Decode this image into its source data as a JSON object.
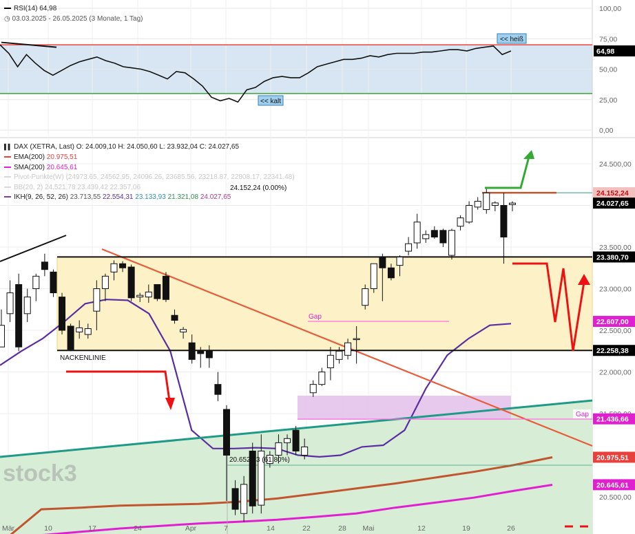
{
  "rsi_panel": {
    "title": "RSI(14)",
    "value": "64,98",
    "subtitle": "03.03.2025 - 26.05.2025",
    "period": "(3 Monate, 1 Tag)",
    "label_hot": "<< heiß",
    "label_cold": "<< kalt",
    "tag_value": "64,98",
    "ticks": [
      "100,00",
      "75,00",
      "50,00",
      "25,00",
      "0,00"
    ]
  },
  "price_panel": {
    "title": "DAX (XETRA, Last)",
    "ohlc": "O: 24.009,10  H: 24.050,60  L: 23.932,04  C: 24.027,65",
    "legend": [
      {
        "label": "EMA(200)",
        "value": "20.975,51",
        "color": "#e8413c",
        "faded": false
      },
      {
        "label": "SMA(200)",
        "value": "20.645,61",
        "color": "#e020d0",
        "faded": false
      },
      {
        "label": "Pivot-Punkte(W)",
        "value": "(24973.65, 24562.95, 24096.26, 23685.56, 23218.87, 22808.17, 22341.48)",
        "color": "#d8d8d8",
        "faded": true
      },
      {
        "label": "BB(20, 2)",
        "value": "24.521,78  23.439,42  22.357,06",
        "color": "#d8d8d8",
        "faded": true
      }
    ],
    "ikh": {
      "label": "IKH(9, 26, 52, 26)",
      "v1": "23.713,55",
      "v2": "22.554,31",
      "v3": "23.133,93",
      "v4": "21.321,08",
      "v5": "24.027,65"
    },
    "high_note": "24.152,24 (0.00%)",
    "fib_note": "20.652,53 (61.80%)",
    "neckline_label": "NACKENLINIE",
    "gap_label_1": "Gap",
    "gap_label_2": "Gap",
    "price_ticks": [
      "24.500,00",
      "24.000,00",
      "23.500,00",
      "23.000,00",
      "22.500,00",
      "22.000,00",
      "21.500,00",
      "21.000,00",
      "20.500,00"
    ],
    "tags": [
      {
        "text": "24.152,24",
        "bg": "#f3c0c0",
        "fg": "#c01010"
      },
      {
        "text": "24.027,65",
        "bg": "#000000",
        "fg": "#ffffff"
      },
      {
        "text": "23.380,70",
        "bg": "#000000",
        "fg": "#ffffff"
      },
      {
        "text": "22.607,00",
        "bg": "#e020d0",
        "fg": "#ffffff"
      },
      {
        "text": "22.258,38",
        "bg": "#000000",
        "fg": "#ffffff"
      },
      {
        "text": "21.436,66",
        "bg": "#e020d0",
        "fg": "#ffffff"
      },
      {
        "text": "20.975,51",
        "bg": "#e8413c",
        "fg": "#ffffff"
      },
      {
        "text": "20.645,61",
        "bg": "#e020d0",
        "fg": "#ffffff"
      }
    ],
    "x_ticks": [
      "Mär",
      "10",
      "17",
      "24",
      "Apr",
      "7",
      "14",
      "22",
      "28",
      "Mai",
      "12",
      "19",
      "26"
    ],
    "watermark": "stock3"
  },
  "chart_data": {
    "type": "candlestick",
    "title": "DAX (XETRA, Last)",
    "period": "03.03.2025 - 26.05.2025",
    "y_range": [
      20250,
      24800
    ],
    "candles": [
      {
        "o": 22300,
        "h": 22750,
        "l": 22300,
        "c": 22560
      },
      {
        "o": 22700,
        "h": 23100,
        "l": 22600,
        "c": 22950
      },
      {
        "o": 23050,
        "h": 23180,
        "l": 22250,
        "c": 22300
      },
      {
        "o": 22700,
        "h": 23000,
        "l": 22600,
        "c": 22900
      },
      {
        "o": 23000,
        "h": 23180,
        "l": 22850,
        "c": 23150
      },
      {
        "o": 23320,
        "h": 23420,
        "l": 23150,
        "c": 23230
      },
      {
        "o": 23200,
        "h": 23230,
        "l": 22900,
        "c": 22950
      },
      {
        "o": 22900,
        "h": 22950,
        "l": 22450,
        "c": 22500
      },
      {
        "o": 22550,
        "h": 22580,
        "l": 22250,
        "c": 22270
      },
      {
        "o": 22480,
        "h": 22620,
        "l": 22400,
        "c": 22530
      },
      {
        "o": 22450,
        "h": 22580,
        "l": 22400,
        "c": 22520
      },
      {
        "o": 22730,
        "h": 23100,
        "l": 22500,
        "c": 23000
      },
      {
        "o": 23000,
        "h": 23180,
        "l": 22850,
        "c": 23150
      },
      {
        "o": 23200,
        "h": 23340,
        "l": 23100,
        "c": 23300
      },
      {
        "o": 23300,
        "h": 23330,
        "l": 23200,
        "c": 23250
      },
      {
        "o": 23260,
        "h": 23290,
        "l": 22850,
        "c": 22890
      },
      {
        "o": 22900,
        "h": 22950,
        "l": 22840,
        "c": 22920
      },
      {
        "o": 22900,
        "h": 23050,
        "l": 22830,
        "c": 22960
      },
      {
        "o": 23050,
        "h": 23050,
        "l": 22850,
        "c": 22880
      },
      {
        "o": 23150,
        "h": 23200,
        "l": 22840,
        "c": 22870
      },
      {
        "o": 22680,
        "h": 22750,
        "l": 22580,
        "c": 22620
      },
      {
        "o": 22480,
        "h": 22540,
        "l": 22400,
        "c": 22510
      },
      {
        "o": 22350,
        "h": 22450,
        "l": 22100,
        "c": 22150
      },
      {
        "o": 22250,
        "h": 22300,
        "l": 22050,
        "c": 22220
      },
      {
        "o": 22250,
        "h": 22320,
        "l": 22050,
        "c": 22170
      },
      {
        "o": 21850,
        "h": 22000,
        "l": 21650,
        "c": 21730
      },
      {
        "o": 21550,
        "h": 21600,
        "l": 20450,
        "c": 21000
      },
      {
        "o": 20600,
        "h": 20700,
        "l": 20280,
        "c": 20350
      },
      {
        "o": 20300,
        "h": 20750,
        "l": 20200,
        "c": 20650
      },
      {
        "o": 21050,
        "h": 21150,
        "l": 20300,
        "c": 20390
      },
      {
        "o": 20400,
        "h": 21250,
        "l": 20300,
        "c": 21050
      },
      {
        "o": 20900,
        "h": 21050,
        "l": 20850,
        "c": 21000
      },
      {
        "o": 21000,
        "h": 21250,
        "l": 20900,
        "c": 21150
      },
      {
        "o": 21150,
        "h": 21250,
        "l": 21000,
        "c": 21200
      },
      {
        "o": 21300,
        "h": 21350,
        "l": 21000,
        "c": 21050
      },
      {
        "o": 21000,
        "h": 21200,
        "l": 20950,
        "c": 21100
      },
      {
        "o": 21750,
        "h": 21900,
        "l": 21700,
        "c": 21850
      },
      {
        "o": 21850,
        "h": 22050,
        "l": 21830,
        "c": 22000
      },
      {
        "o": 22050,
        "h": 22300,
        "l": 21900,
        "c": 22200
      },
      {
        "o": 22150,
        "h": 22300,
        "l": 22100,
        "c": 22250
      },
      {
        "o": 22200,
        "h": 22400,
        "l": 22150,
        "c": 22350
      },
      {
        "o": 22400,
        "h": 22550,
        "l": 22100,
        "c": 22400
      },
      {
        "o": 22800,
        "h": 23050,
        "l": 22750,
        "c": 23000
      },
      {
        "o": 23000,
        "h": 23300,
        "l": 22950,
        "c": 23300
      },
      {
        "o": 23380,
        "h": 23420,
        "l": 22850,
        "c": 23250
      },
      {
        "o": 23250,
        "h": 23300,
        "l": 23100,
        "c": 23130
      },
      {
        "o": 23280,
        "h": 23400,
        "l": 23150,
        "c": 23380
      },
      {
        "o": 23450,
        "h": 23620,
        "l": 23400,
        "c": 23540
      },
      {
        "o": 23550,
        "h": 23900,
        "l": 23480,
        "c": 23800
      },
      {
        "o": 23600,
        "h": 23700,
        "l": 23550,
        "c": 23650
      },
      {
        "o": 23700,
        "h": 23750,
        "l": 23600,
        "c": 23620
      },
      {
        "o": 23700,
        "h": 23720,
        "l": 23500,
        "c": 23550
      },
      {
        "o": 23400,
        "h": 23720,
        "l": 23350,
        "c": 23700
      },
      {
        "o": 23750,
        "h": 23880,
        "l": 23700,
        "c": 23850
      },
      {
        "o": 23800,
        "h": 24050,
        "l": 23780,
        "c": 24000
      },
      {
        "o": 23980,
        "h": 24100,
        "l": 23950,
        "c": 24050
      },
      {
        "o": 23950,
        "h": 24200,
        "l": 23900,
        "c": 24150
      },
      {
        "o": 24000,
        "h": 24050,
        "l": 23930,
        "c": 24030
      },
      {
        "o": 24000,
        "h": 24150,
        "l": 23300,
        "c": 23620
      },
      {
        "o": 24010,
        "h": 24050,
        "l": 23930,
        "c": 24028
      }
    ],
    "lines": {
      "EMA(200)": [
        20350,
        20370,
        20395,
        20405,
        20415,
        20440,
        20480,
        20540,
        20600,
        20660,
        20730,
        20800,
        20880,
        20975
      ],
      "SMA(200)": [
        20040,
        20080,
        20120,
        20150,
        20180,
        20200,
        20225,
        20260,
        20300,
        20370,
        20430,
        20490,
        20570,
        20645
      ],
      "IKH": [
        22080,
        22250,
        22400,
        22600,
        22820,
        22870,
        22860,
        22700,
        22250,
        21300,
        21080,
        21080,
        21090,
        21080,
        21000,
        20980,
        21000,
        21100,
        21120,
        21300,
        21800,
        22200,
        22400,
        22560,
        22580
      ]
    },
    "levels": {
      "high": 24152.24,
      "last": 24027.65,
      "zone_upper": 23380.7,
      "zone_lower": 22258.38,
      "gap_upper": 22607.0,
      "gap_lower": 21436.66,
      "ema200": 20975.51,
      "sma200": 20645.61,
      "fib_61_8": 20652.53
    },
    "rsi": {
      "value": 64.98,
      "range": [
        0,
        100
      ],
      "upper": 70,
      "lower": 30,
      "series": [
        70,
        63,
        52,
        62,
        55,
        49,
        45,
        49,
        53,
        56,
        58,
        60,
        57,
        55,
        52,
        51,
        50,
        48,
        45,
        42,
        48,
        47,
        42,
        36,
        27,
        24,
        26,
        23,
        33,
        35,
        40,
        43,
        44,
        43,
        43,
        47,
        52,
        54,
        56,
        58,
        58,
        59,
        61,
        60,
        62,
        63,
        63,
        63,
        64,
        64,
        65,
        66,
        66,
        65,
        67,
        68,
        69,
        62,
        64.98
      ]
    }
  }
}
